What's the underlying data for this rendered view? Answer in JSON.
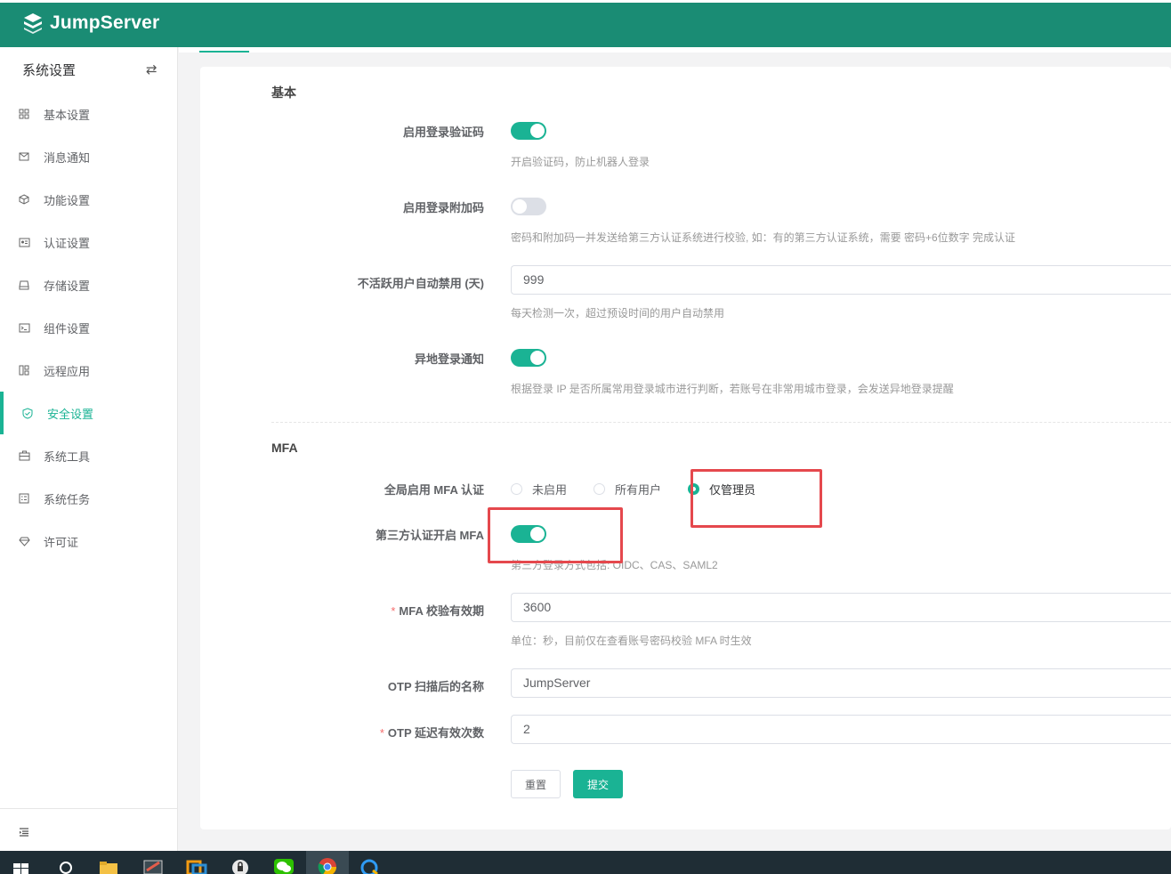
{
  "app": {
    "name": "JumpServer"
  },
  "sidebar": {
    "title": "系统设置",
    "items": [
      {
        "label": "基本设置",
        "icon": "grid-icon"
      },
      {
        "label": "消息通知",
        "icon": "message-icon"
      },
      {
        "label": "功能设置",
        "icon": "cube-icon"
      },
      {
        "label": "认证设置",
        "icon": "id-card-icon"
      },
      {
        "label": "存储设置",
        "icon": "storage-icon"
      },
      {
        "label": "组件设置",
        "icon": "terminal-icon"
      },
      {
        "label": "远程应用",
        "icon": "apps-icon"
      },
      {
        "label": "安全设置",
        "icon": "shield-check-icon",
        "active": true
      },
      {
        "label": "系统工具",
        "icon": "toolbox-icon"
      },
      {
        "label": "系统任务",
        "icon": "tasks-icon"
      },
      {
        "label": "许可证",
        "icon": "license-icon"
      }
    ]
  },
  "form": {
    "basic": {
      "title": "基本",
      "login_captcha": {
        "label": "启用登录验证码",
        "enabled": true,
        "help": "开启验证码，防止机器人登录"
      },
      "login_extra_code": {
        "label": "启用登录附加码",
        "enabled": false,
        "help": "密码和附加码一并发送给第三方认证系统进行校验, 如：有的第三方认证系统，需要 密码+6位数字 完成认证"
      },
      "inactive_disable": {
        "label": "不活跃用户自动禁用 (天)",
        "value": "999",
        "help": "每天检测一次，超过预设时间的用户自动禁用"
      },
      "remote_login_notify": {
        "label": "异地登录通知",
        "enabled": true,
        "help": "根据登录 IP 是否所属常用登录城市进行判断，若账号在非常用城市登录，会发送异地登录提醒"
      }
    },
    "mfa": {
      "title": "MFA",
      "global_mfa": {
        "label": "全局启用 MFA 认证",
        "options": [
          {
            "label": "未启用",
            "checked": false
          },
          {
            "label": "所有用户",
            "checked": false
          },
          {
            "label": "仅管理员",
            "checked": true
          }
        ]
      },
      "third_party_mfa": {
        "label": "第三方认证开启 MFA",
        "enabled": true,
        "help": "第三方登录方式包括: OIDC、CAS、SAML2"
      },
      "mfa_verify_ttl": {
        "label": "MFA 校验有效期",
        "required": "*",
        "value": "3600",
        "help": "单位：秒，目前仅在查看账号密码校验 MFA 时生效"
      },
      "otp_issuer_name": {
        "label": "OTP 扫描后的名称",
        "value": "JumpServer"
      },
      "otp_valid_window": {
        "label": "OTP 延迟有效次数",
        "required": "*",
        "value": "2"
      }
    },
    "buttons": {
      "reset": "重置",
      "submit": "提交"
    }
  },
  "colors": {
    "brand": "#1a8c74",
    "accent": "#1ab394",
    "highlight": "#e5484d"
  }
}
